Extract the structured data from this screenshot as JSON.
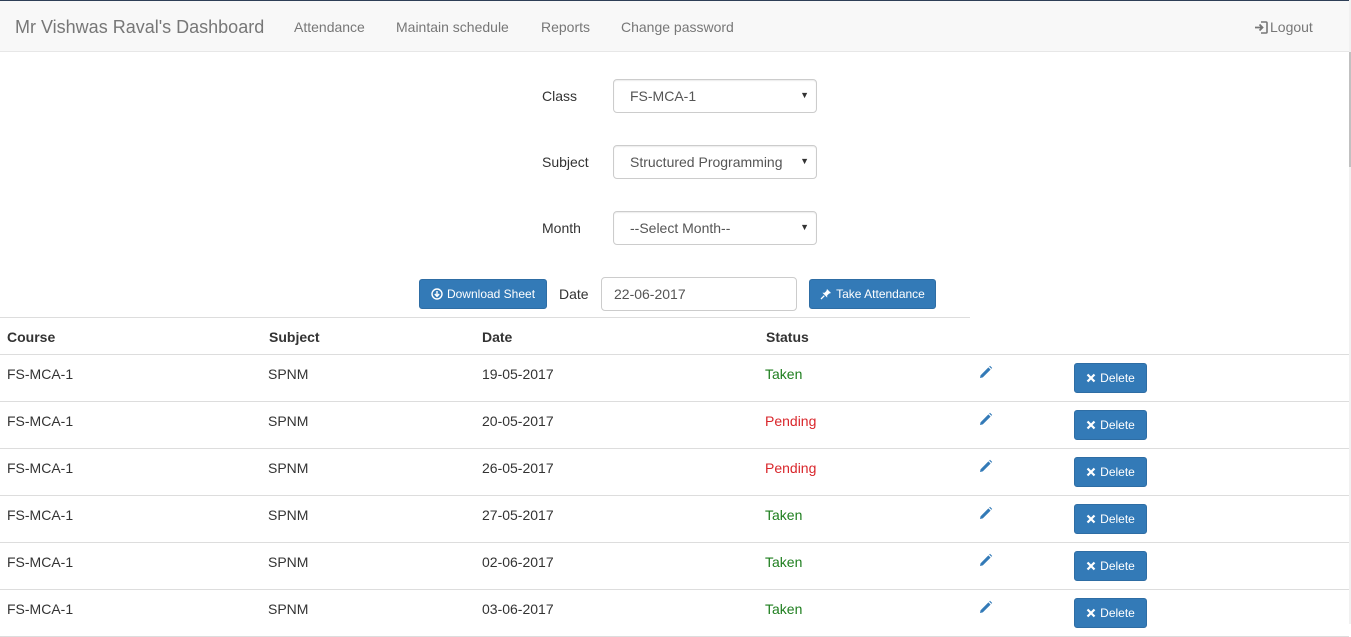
{
  "navbar": {
    "brand": "Mr Vishwas Raval's Dashboard",
    "links": [
      "Attendance",
      "Maintain schedule",
      "Reports",
      "Change password"
    ],
    "logout": "Logout"
  },
  "form": {
    "class_label": "Class",
    "class_value": "FS-MCA-1",
    "subject_label": "Subject",
    "subject_value": "Structured Programming",
    "month_label": "Month",
    "month_value": "--Select Month--"
  },
  "controls": {
    "download_label": "Download Sheet",
    "date_label": "Date",
    "date_value": "22-06-2017",
    "take_label": "Take Attendance"
  },
  "table": {
    "headers": [
      "Course",
      "Subject",
      "Date",
      "Status"
    ],
    "delete_label": "Delete",
    "rows": [
      {
        "course": "FS-MCA-1",
        "subject": "SPNM",
        "date": "19-05-2017",
        "status": "Taken"
      },
      {
        "course": "FS-MCA-1",
        "subject": "SPNM",
        "date": "20-05-2017",
        "status": "Pending"
      },
      {
        "course": "FS-MCA-1",
        "subject": "SPNM",
        "date": "26-05-2017",
        "status": "Pending"
      },
      {
        "course": "FS-MCA-1",
        "subject": "SPNM",
        "date": "27-05-2017",
        "status": "Taken"
      },
      {
        "course": "FS-MCA-1",
        "subject": "SPNM",
        "date": "02-06-2017",
        "status": "Taken"
      },
      {
        "course": "FS-MCA-1",
        "subject": "SPNM",
        "date": "03-06-2017",
        "status": "Taken"
      }
    ]
  },
  "colors": {
    "primary": "#337ab7",
    "taken": "#1e7e1e",
    "pending": "#d9262b",
    "navbar_bg": "#f8f8f8"
  },
  "icons": {
    "download": "download-circle-icon",
    "take": "pushpin-icon",
    "logout": "log-in-icon",
    "edit": "pencil-icon",
    "delete": "remove-icon"
  }
}
